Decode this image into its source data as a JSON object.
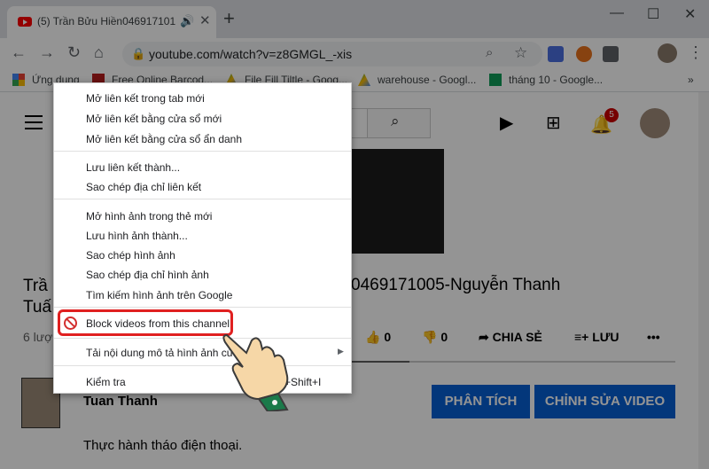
{
  "tab": {
    "title": "(5) Trần Bửu Hiền046917101",
    "speaker_icon": "🔊",
    "close_icon": "✕"
  },
  "newtab_icon": "+",
  "window_controls": {
    "minimize": "—",
    "maximize": "☐",
    "close": "✕"
  },
  "nav": {
    "back": "←",
    "forward": "→",
    "reload": "↻",
    "home": "⌂"
  },
  "address": {
    "url": "youtube.com/watch?v=z8GMGL_-xis"
  },
  "bookmarks": {
    "apps": "Ứng dụng",
    "items": [
      "Free Online Barcod...",
      "File Fill Tiltle - Goog...",
      "warehouse - Googl...",
      "tháng 10 - Google..."
    ],
    "more": "»"
  },
  "youtube": {
    "notification_count": "5",
    "title_line1": "Trầ",
    "title_line1_rest": "0469171005-Nguyễn Thanh",
    "title_line2": "Tuấ",
    "views": "6 lượ",
    "likes": "0",
    "dislikes": "0",
    "share": "CHIA SẺ",
    "save": "LƯU",
    "more_dots": "•••",
    "channel": "Tuan Thanh",
    "analyze_btn": "PHÂN TÍCH",
    "edit_btn": "CHỈNH SỬA VIDEO",
    "description": "Thực hành tháo điện thoại."
  },
  "context_menu": {
    "group1": [
      "Mở liên kết trong tab mới",
      "Mở liên kết bằng cửa sổ mới",
      "Mở liên kết bằng cửa sổ ẩn danh"
    ],
    "group2": [
      "Lưu liên kết thành...",
      "Sao chép địa chỉ liên kết"
    ],
    "group3": [
      "Mở hình ảnh trong thẻ mới",
      "Lưu hình ảnh thành...",
      "Sao chép hình ảnh",
      "Sao chép địa chỉ hình ảnh",
      "Tìm kiếm hình ảnh trên Google"
    ],
    "block": "Block videos from this channel",
    "download": "Tải nội dung mô tả hình ảnh cứ",
    "inspect": "Kiểm tra",
    "inspect_shortcut": "+Shift+I",
    "submenu_arrow": "▶"
  },
  "colors": {
    "highlight": "#e02020",
    "blue_button": "#065fd4",
    "badge": "#cc0000"
  }
}
